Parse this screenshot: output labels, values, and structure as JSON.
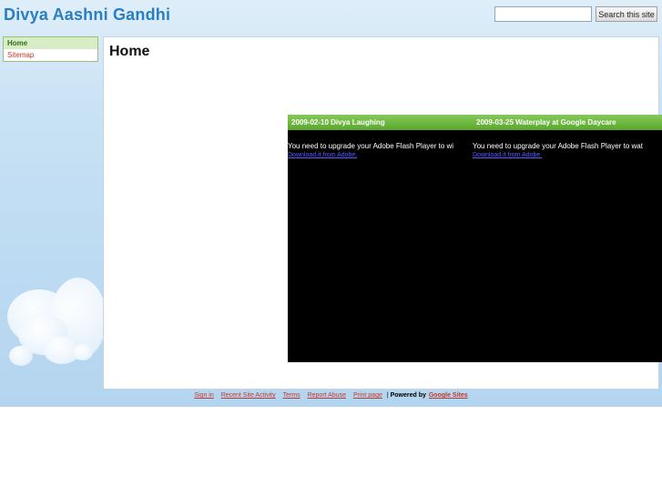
{
  "site": {
    "title": "Divya Aashni Gandhi"
  },
  "search": {
    "placeholder": "",
    "button_label": "Search this site"
  },
  "sidebar": {
    "items": [
      {
        "label": "Home"
      },
      {
        "label": "Sitemap"
      }
    ]
  },
  "main": {
    "page_title": "Home",
    "gadgets": [
      {
        "title": "2009-02-10 Divya Laughing",
        "message": "You need to upgrade your Adobe Flash Player to wi",
        "link": "Download it from Adobe."
      },
      {
        "title": "2009-03-25 Waterplay at Google Daycare",
        "message": "You need to upgrade your Adobe Flash Player to wat",
        "link": "Download it from Adobe."
      }
    ]
  },
  "footer": {
    "links": [
      "Sign in",
      "Recent Site Activity",
      "Terms",
      "Report Abuse",
      "Print page"
    ],
    "separator": "|",
    "powered_text": "Powered by",
    "powered_link": "Google Sites"
  },
  "colors": {
    "accent": "#2a7ec3",
    "link": "#c0392b",
    "gadget_header": "#6bb63f"
  }
}
